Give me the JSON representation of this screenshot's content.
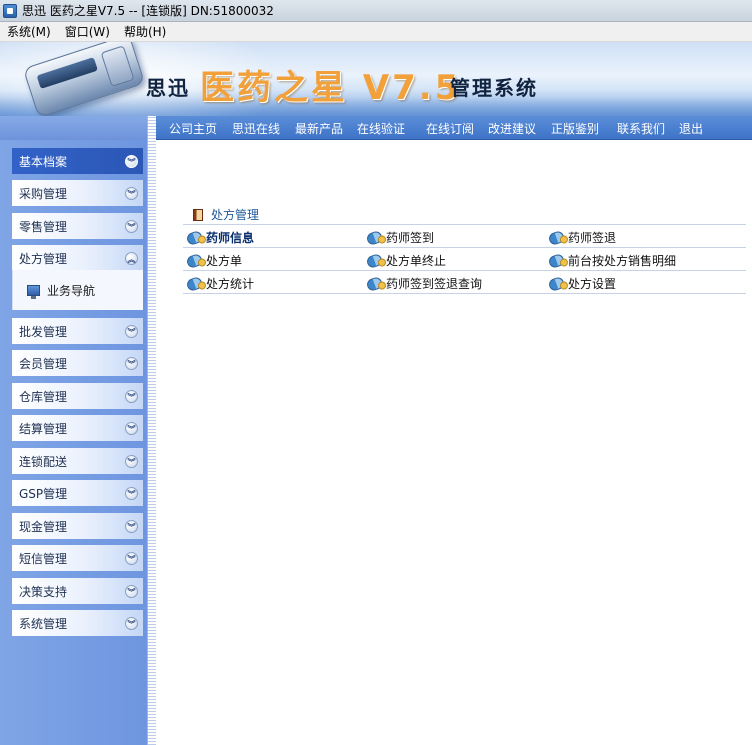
{
  "window": {
    "title": "思迅 医药之星V7.5 -- [连锁版] DN:51800032"
  },
  "menubar": {
    "items": [
      "系统(M)",
      "窗口(W)",
      "帮助(H)"
    ]
  },
  "banner": {
    "company": "思迅",
    "product": "医药之星 V7.5",
    "suffix": "管理系统"
  },
  "topnav": {
    "links": [
      "公司主页",
      "思迅在线",
      "最新产品",
      "在线验证",
      "在线订阅",
      "改进建议",
      "正版鉴别",
      "联系我们",
      "退出"
    ]
  },
  "sidebar": {
    "items": [
      {
        "label": "基本档案",
        "state": "active"
      },
      {
        "label": "采购管理",
        "state": "collapsed"
      },
      {
        "label": "零售管理",
        "state": "collapsed"
      },
      {
        "label": "处方管理",
        "state": "expanded"
      },
      {
        "label": "批发管理",
        "state": "collapsed"
      },
      {
        "label": "会员管理",
        "state": "collapsed"
      },
      {
        "label": "仓库管理",
        "state": "collapsed"
      },
      {
        "label": "结算管理",
        "state": "collapsed"
      },
      {
        "label": "连锁配送",
        "state": "collapsed"
      },
      {
        "label": "GSP管理",
        "state": "collapsed"
      },
      {
        "label": "现金管理",
        "state": "collapsed"
      },
      {
        "label": "短信管理",
        "state": "collapsed"
      },
      {
        "label": "决策支持",
        "state": "collapsed"
      },
      {
        "label": "系统管理",
        "state": "collapsed"
      }
    ],
    "subitem": {
      "label": "业务导航"
    }
  },
  "content": {
    "section_title": "处方管理",
    "functions": [
      [
        "药师信息",
        "药师签到",
        "药师签退"
      ],
      [
        "处方单",
        "处方单终止",
        "前台按处方销售明细"
      ],
      [
        "处方统计",
        "药师签到签退查询",
        "处方设置"
      ]
    ]
  },
  "icons": {
    "collapsed": "double-chevron-down-icon",
    "expanded": "double-chevron-up-icon",
    "function": "pill-icon",
    "section": "book-icon",
    "subitem": "monitor-icon"
  },
  "colors": {
    "sidebar_bg": "#7fa5e6",
    "active_header": "#3262c8",
    "topnav_bg": "#4a7fd0",
    "brand_orange": "#f2a03a"
  }
}
